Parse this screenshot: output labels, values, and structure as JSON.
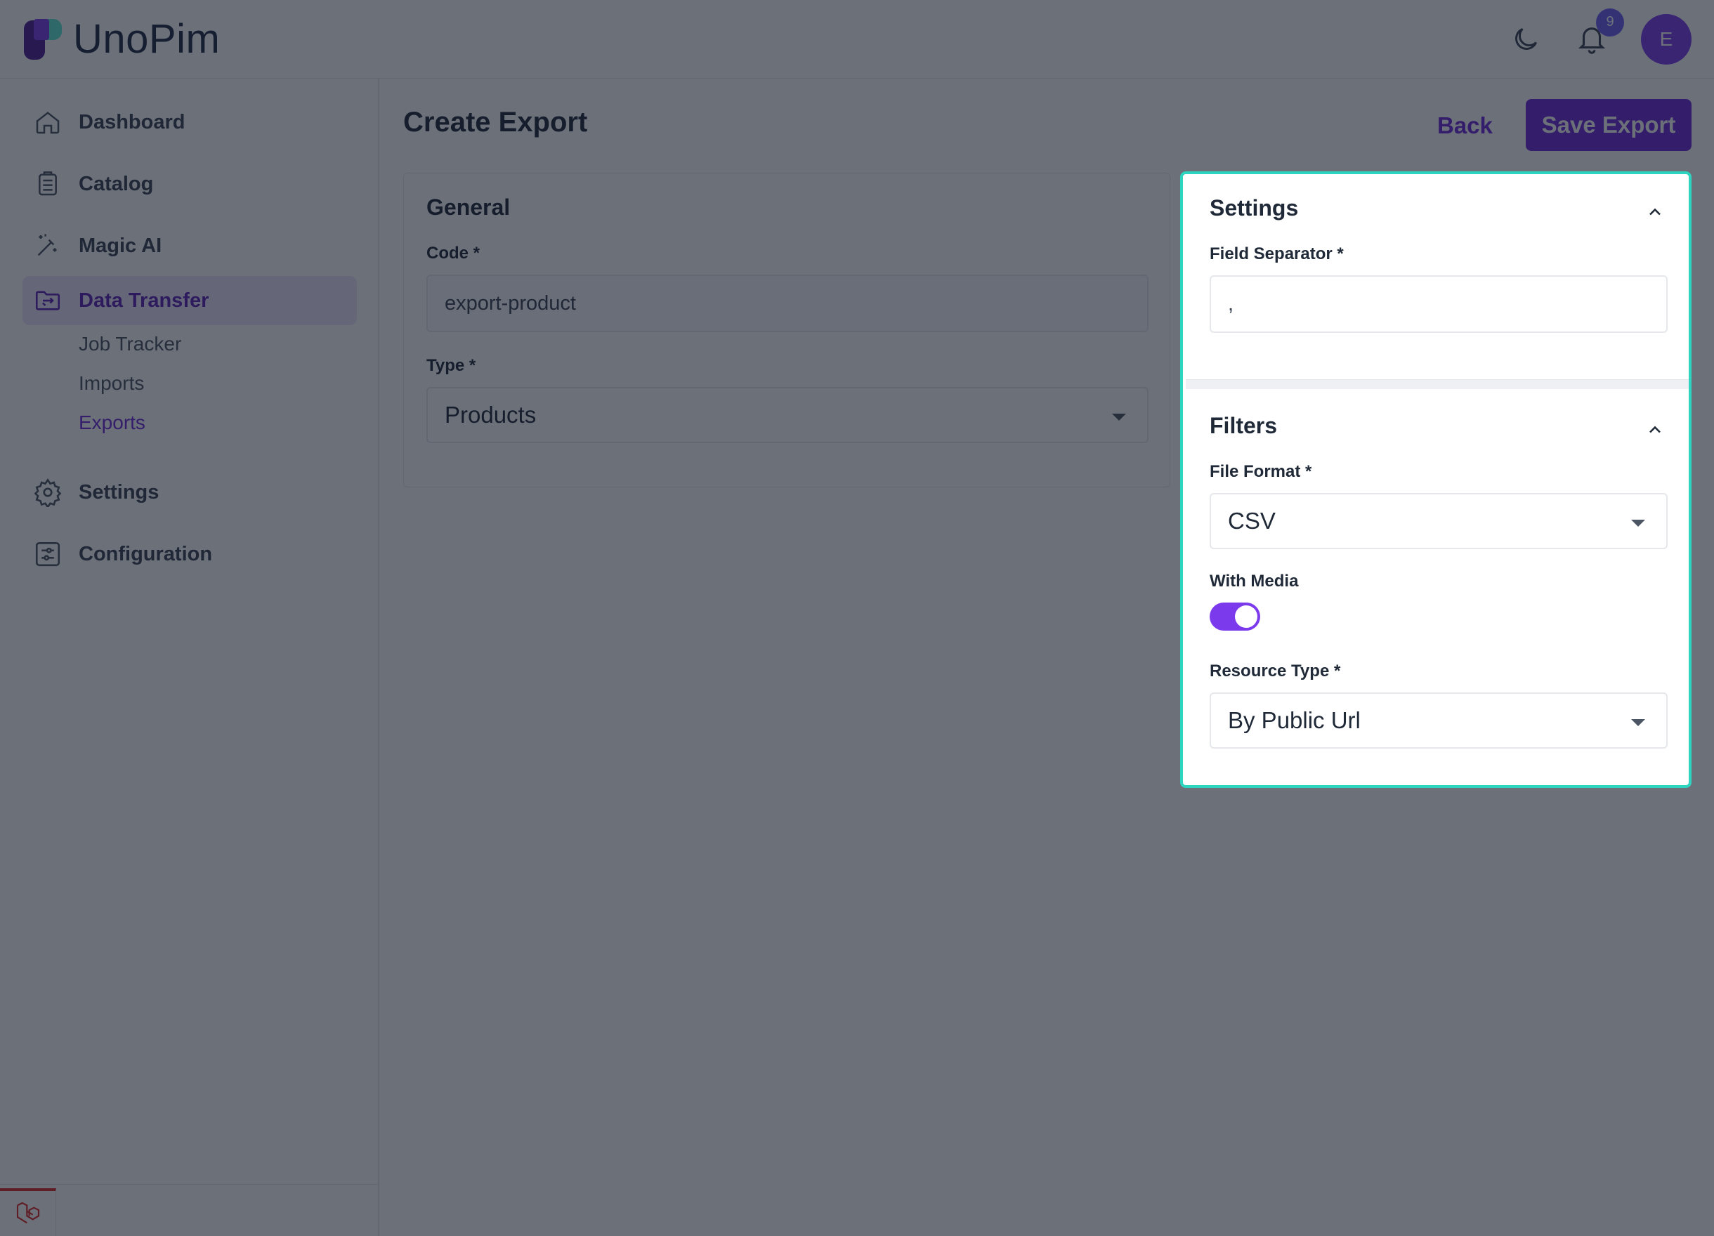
{
  "app": {
    "logo_text": "UnoPim"
  },
  "header": {
    "notification_count": "9",
    "avatar_initial": "E"
  },
  "sidebar": {
    "items": [
      {
        "label": "Dashboard",
        "icon": "home-icon"
      },
      {
        "label": "Catalog",
        "icon": "clipboard-icon"
      },
      {
        "label": "Magic AI",
        "icon": "magic-wand-icon"
      },
      {
        "label": "Data Transfer",
        "icon": "folder-transfer-icon",
        "active": true
      },
      {
        "label": "Settings",
        "icon": "gear-icon"
      },
      {
        "label": "Configuration",
        "icon": "sliders-icon"
      }
    ],
    "sub_items": [
      {
        "label": "Job Tracker"
      },
      {
        "label": "Imports"
      },
      {
        "label": "Exports",
        "active": true
      }
    ]
  },
  "page": {
    "title": "Create Export",
    "back_label": "Back",
    "save_label": "Save Export"
  },
  "general": {
    "title": "General",
    "code_label": "Code",
    "code_value": "export-product",
    "type_label": "Type",
    "type_value": "Products"
  },
  "settings": {
    "title": "Settings",
    "field_separator_label": "Field Separator",
    "field_separator_value": ","
  },
  "filters": {
    "title": "Filters",
    "file_format_label": "File Format",
    "file_format_value": "CSV",
    "with_media_label": "With Media",
    "with_media_on": true,
    "resource_type_label": "Resource Type",
    "resource_type_value": "By Public Url"
  },
  "required_marker": "*",
  "colors": {
    "accent": "#6d28d9",
    "highlight_border": "#2dd4bf"
  }
}
